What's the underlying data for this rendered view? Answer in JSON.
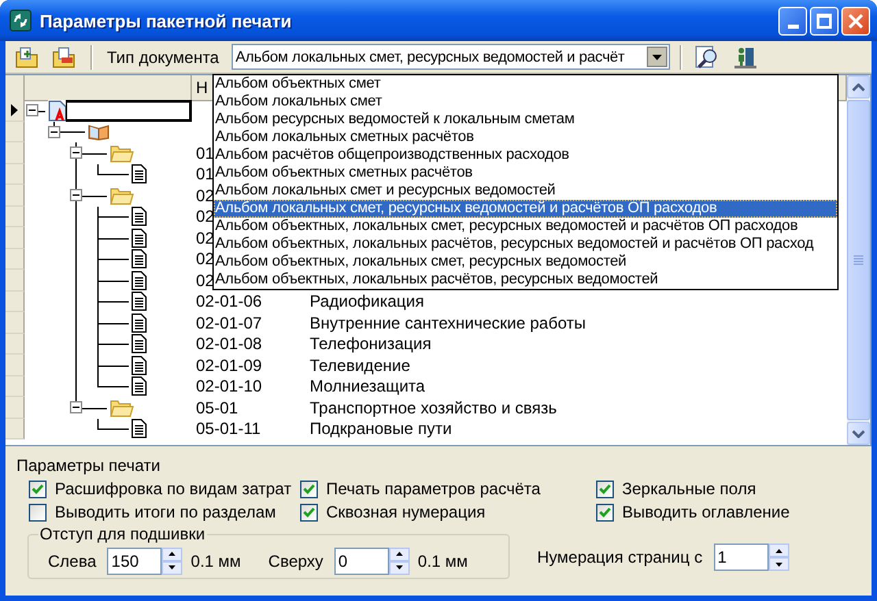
{
  "window": {
    "title": "Параметры пакетной печати"
  },
  "toolbar": {
    "label": "Тип документа",
    "document_type": {
      "value": "Альбом локальных смет, ресурсных ведомостей и расчёт",
      "open": true,
      "options": [
        {
          "label": "Альбом объектных смет",
          "selected": false
        },
        {
          "label": "Альбом локальных смет",
          "selected": false
        },
        {
          "label": "Альбом ресурсных ведомостей к локальным сметам",
          "selected": false
        },
        {
          "label": "Альбом локальных сметных расчётов",
          "selected": false
        },
        {
          "label": "Альбом расчётов общепроизводственных расходов",
          "selected": false
        },
        {
          "label": "Альбом объектных сметных расчётов",
          "selected": false
        },
        {
          "label": "Альбом локальных смет и ресурсных ведомостей",
          "selected": false
        },
        {
          "label": "Альбом локальных смет, ресурсных ведомостей и расчётов ОП расходов",
          "selected": true
        },
        {
          "label": "Альбом объектных, локальных смет, ресурсных ведомостей и расчётов ОП расходов",
          "selected": false
        },
        {
          "label": "Альбом объектных, локальных расчётов, ресурсных ведомостей и расчётов ОП расход",
          "selected": false
        },
        {
          "label": "Альбом объектных, локальных смет, ресурсных ведомостей",
          "selected": false
        },
        {
          "label": "Альбом объектных, локальных расчётов, ресурсных ведомостей",
          "selected": false
        }
      ]
    }
  },
  "grid": {
    "code_header": "Н"
  },
  "tree": {
    "nodes": [
      {
        "kind": "document",
        "selected": true,
        "editing": true,
        "expanded": true,
        "children": [
          {
            "kind": "book",
            "selected": false,
            "expanded": true,
            "children": [
              {
                "kind": "folder",
                "selected": false,
                "expanded": true,
                "code": "01",
                "children": [
                  {
                    "kind": "file",
                    "selected": false,
                    "code": "01"
                  }
                ]
              },
              {
                "kind": "folder",
                "selected": false,
                "expanded": true,
                "code": "02",
                "children": [
                  {
                    "kind": "file",
                    "selected": false,
                    "code": "02"
                  },
                  {
                    "kind": "file",
                    "selected": false,
                    "code": "02"
                  },
                  {
                    "kind": "file",
                    "selected": false,
                    "code": "02"
                  },
                  {
                    "kind": "file",
                    "selected": false,
                    "code": "02"
                  },
                  {
                    "kind": "file",
                    "selected": false,
                    "code": "02-01-06",
                    "name": "Радиофикация"
                  },
                  {
                    "kind": "file",
                    "selected": false,
                    "code": "02-01-07",
                    "name": "Внутренние сантехнические работы"
                  },
                  {
                    "kind": "file",
                    "selected": false,
                    "code": "02-01-08",
                    "name": "Телефонизация"
                  },
                  {
                    "kind": "file",
                    "selected": false,
                    "code": "02-01-09",
                    "name": "Телевидение"
                  },
                  {
                    "kind": "file",
                    "selected": false,
                    "code": "02-01-10",
                    "name": "Молниезащита"
                  }
                ]
              },
              {
                "kind": "folder",
                "selected": false,
                "expanded": true,
                "code": "05-01",
                "name": "Транспортное хозяйство и связь",
                "children": [
                  {
                    "kind": "file",
                    "selected": false,
                    "code": "05-01-11",
                    "name": "Подкрановые пути"
                  }
                ]
              }
            ]
          }
        ]
      }
    ]
  },
  "print_params": {
    "title": "Параметры печати",
    "checkboxes": [
      {
        "label": "Расшифровка по видам затрат",
        "checked": true
      },
      {
        "label": "Печать параметров расчёта",
        "checked": true
      },
      {
        "label": "Зеркальные поля",
        "checked": true
      },
      {
        "label": "Выводить итоги по разделам",
        "checked": false
      },
      {
        "label": "Сквозная нумерация",
        "checked": true
      },
      {
        "label": "Выводить оглавление",
        "checked": true
      }
    ]
  },
  "binding_margin": {
    "title": "Отступ для подшивки",
    "fields": [
      {
        "label": "Слева",
        "value": "150",
        "unit": "0.1 мм"
      },
      {
        "label": "Сверху",
        "value": "0",
        "unit": "0.1 мм"
      }
    ]
  },
  "page_numbering": {
    "label": "Нумерация страниц с",
    "value": "1"
  }
}
